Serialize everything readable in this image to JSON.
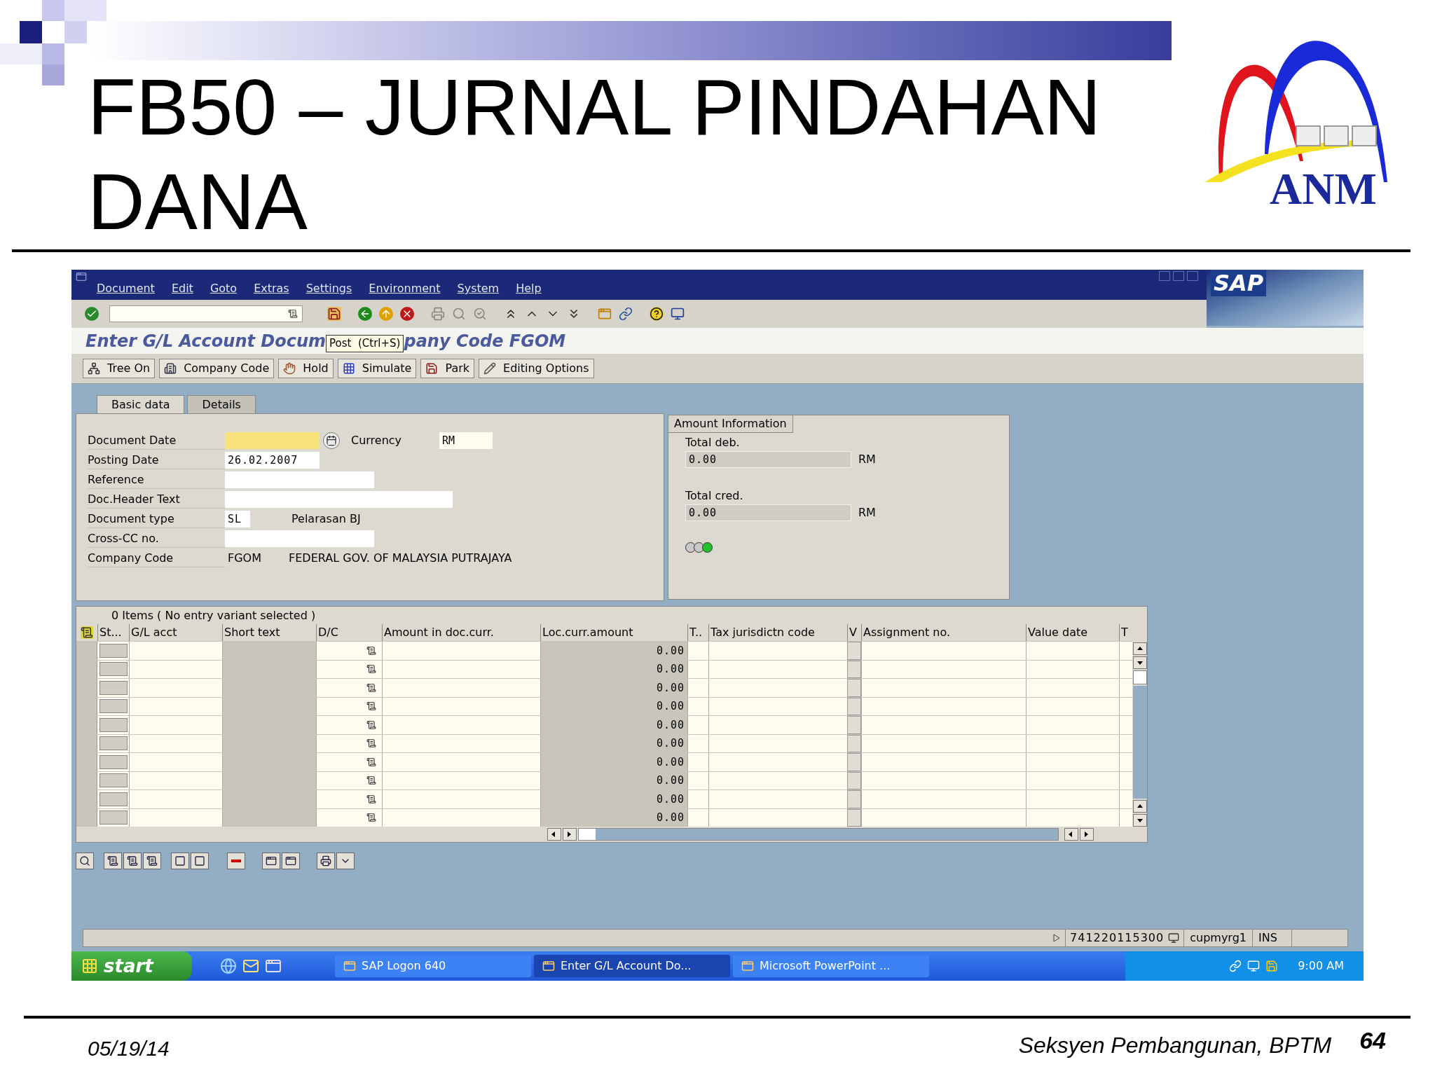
{
  "slide": {
    "title_lines": [
      "FB50 – JURNAL PINDAHAN",
      "DANA"
    ],
    "logo_text": "ANM",
    "footer_date": "05/19/14",
    "footer_text": "Seksyen Pembangunan, BPTM",
    "page_number": "64"
  },
  "sap": {
    "menu": [
      "Document",
      "Edit",
      "Goto",
      "Extras",
      "Settings",
      "Environment",
      "System",
      "Help"
    ],
    "logo": "SAP",
    "screen_title_parts": [
      "Enter G/L Account Docum",
      "pany Code FGOM"
    ],
    "tooltip": "Post  (Ctrl+S)",
    "app_buttons": [
      {
        "label": "Tree On",
        "kind": "tree"
      },
      {
        "label": "Company Code",
        "kind": "company"
      },
      {
        "label": "Hold",
        "kind": "hold"
      },
      {
        "label": "Simulate",
        "kind": "simulate"
      },
      {
        "label": "Park",
        "kind": "park"
      },
      {
        "label": "Editing Options",
        "kind": "edit"
      }
    ],
    "tabs": [
      {
        "label": "Basic data",
        "selected": true
      },
      {
        "label": "Details",
        "selected": false
      }
    ],
    "fields": [
      {
        "label": "Document Date",
        "kind": "input",
        "highlighted": true,
        "picker": true,
        "side": {
          "label": "Currency",
          "value": "RM"
        }
      },
      {
        "label": "Posting Date",
        "kind": "input",
        "highlighted": false,
        "picker": false,
        "value": "26.02.2007"
      },
      {
        "label": "Reference",
        "kind": "input",
        "highlighted": false,
        "picker": false
      },
      {
        "label": "Doc.Header Text",
        "kind": "input",
        "highlighted": false,
        "picker": false
      },
      {
        "label": "Document type",
        "kind": "input",
        "highlighted": false,
        "picker": false,
        "value": "SL",
        "description": "Pelarasan BJ"
      },
      {
        "label": "Cross-CC no.",
        "kind": "input",
        "highlighted": false,
        "picker": false
      },
      {
        "label": "Company Code",
        "kind": "text",
        "highlighted": false,
        "picker": false,
        "value": "FGOM",
        "description": "FEDERAL GOV. OF MALAYSIA PUTRAJAYA"
      }
    ],
    "amount_info": {
      "title": "Amount Information",
      "totals": [
        {
          "label": "Total deb.",
          "value": "0.00",
          "currency": "RM"
        },
        {
          "label": "Total cred.",
          "value": "0.00",
          "currency": "RM"
        }
      ],
      "lights": [
        {
          "color": "#c8c8c8"
        },
        {
          "color": "#c8c8c8"
        },
        {
          "color": "#22c02a"
        }
      ]
    },
    "table": {
      "caption": "0 Items ( No entry variant selected )",
      "columns": [
        "St...",
        "G/L acct",
        "Short text",
        "D/C",
        "Amount in doc.curr.",
        "Loc.curr.amount",
        "T..",
        "Tax jurisdictn code",
        "V",
        "Assignment no.",
        "Value date",
        "T"
      ],
      "rows": [
        {
          "loc_curr_amount": "0.00"
        },
        {
          "loc_curr_amount": "0.00"
        },
        {
          "loc_curr_amount": "0.00"
        },
        {
          "loc_curr_amount": "0.00"
        },
        {
          "loc_curr_amount": "0.00"
        },
        {
          "loc_curr_amount": "0.00"
        },
        {
          "loc_curr_amount": "0.00"
        },
        {
          "loc_curr_amount": "0.00"
        },
        {
          "loc_curr_amount": "0.00"
        },
        {
          "loc_curr_amount": "0.00"
        }
      ]
    },
    "status_bar": {
      "system": "741220115300",
      "user": "cupmyrg1",
      "mode": "INS"
    },
    "taskbar": {
      "start": "start",
      "tasks": [
        {
          "label": "SAP Logon 640",
          "selected": false
        },
        {
          "label": "Enter G/L Account Do...",
          "selected": true
        },
        {
          "label": "Microsoft PowerPoint ...",
          "selected": false
        }
      ],
      "clock": "9:00 AM"
    }
  }
}
